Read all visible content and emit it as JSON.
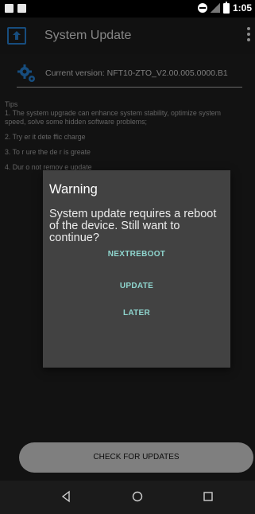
{
  "status_bar": {
    "time": "1:05",
    "icons": [
      "image-notification-icon",
      "sd-card-icon",
      "do-not-disturb-icon",
      "no-signal-icon",
      "battery-icon"
    ]
  },
  "toolbar": {
    "title": "System Update",
    "icon": "system-update-icon",
    "menu_icon": "overflow-menu-icon"
  },
  "version": {
    "icon": "gear-icon",
    "text": "Current version: NFT10-ZTO_V2.00.005.0000.B1"
  },
  "tips": {
    "heading": "Tips",
    "items": [
      "1. The system upgrade can enhance system stability, optimize system speed, solve some hidden software problems;",
      "2. Try er it dete ffic charge",
      "3. To r ure the de r is greate",
      "4. Dur o not remov e update"
    ]
  },
  "dialog": {
    "title": "Warning",
    "message": "System update requires a reboot of the device. Still want to continue?",
    "buttons": [
      "NEXTREBOOT",
      "UPDATE",
      "LATER"
    ]
  },
  "check_button": {
    "label": "CHECK FOR UPDATES"
  },
  "nav_bar": {
    "icons": [
      "back-icon",
      "home-icon",
      "recent-apps-icon"
    ]
  },
  "colors": {
    "accent": "#2a8de6",
    "dialog_button": "#8fd6cf",
    "dialog_background": "#424242",
    "screen_background": "#212121"
  }
}
